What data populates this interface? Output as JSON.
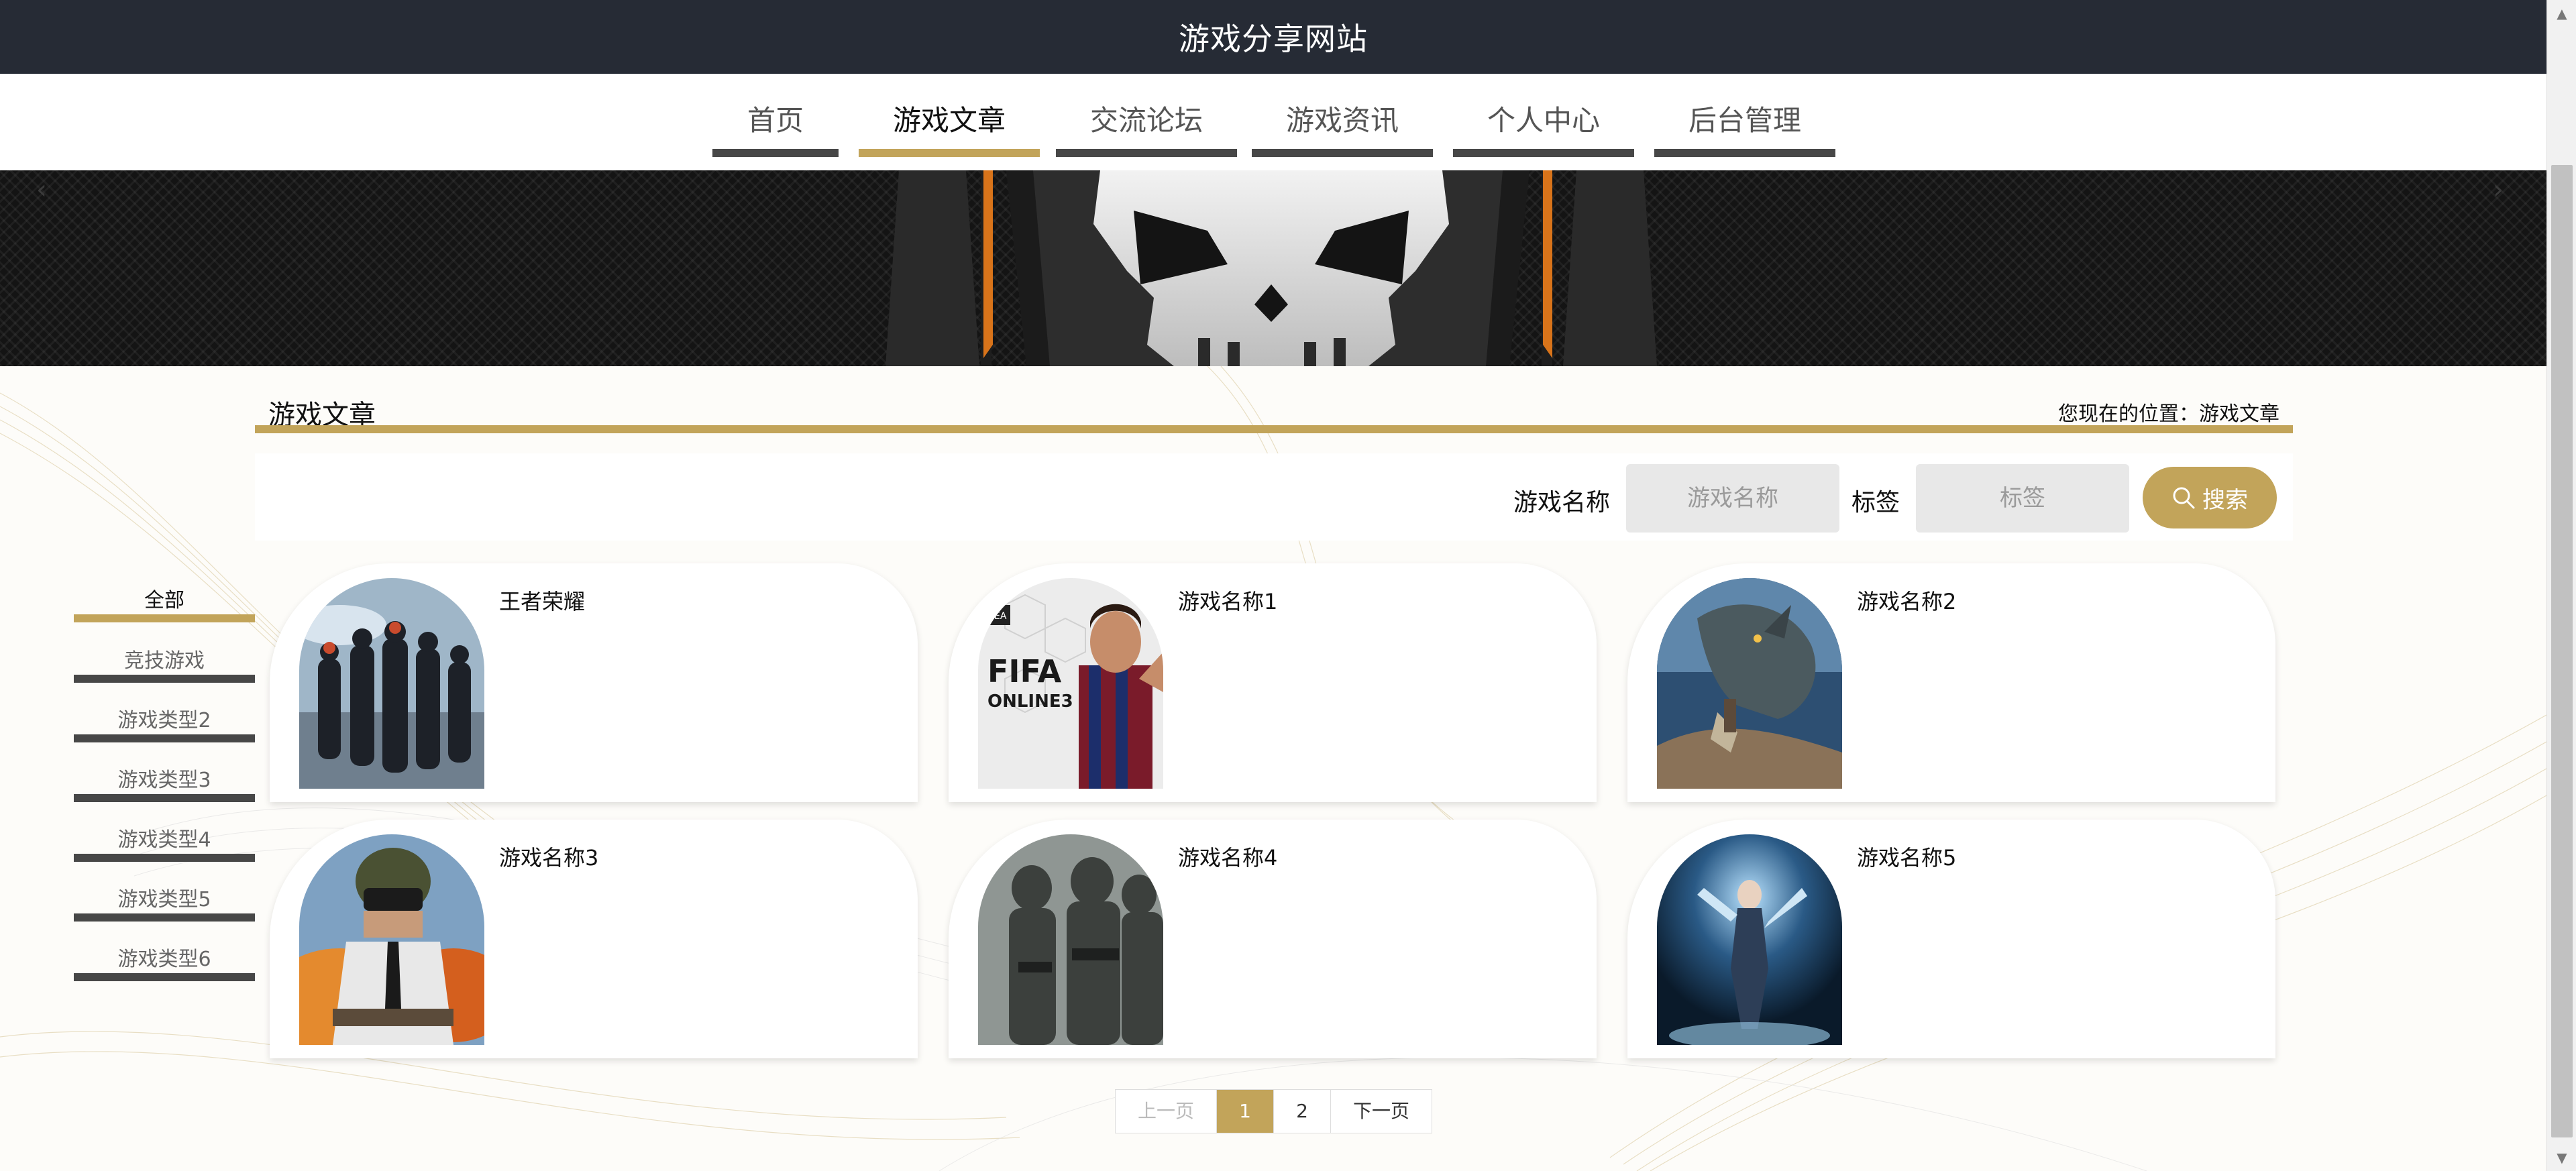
{
  "site": {
    "title": "游戏分享网站"
  },
  "nav": {
    "items": [
      {
        "label": "首页",
        "active": false
      },
      {
        "label": "游戏文章",
        "active": true
      },
      {
        "label": "交流论坛",
        "active": false
      },
      {
        "label": "游戏资讯",
        "active": false
      },
      {
        "label": "个人中心",
        "active": false
      },
      {
        "label": "后台管理",
        "active": false
      }
    ]
  },
  "banner": {
    "prev_icon": "chevron-left-icon",
    "next_icon": "chevron-right-icon"
  },
  "section": {
    "title": "游戏文章",
    "breadcrumb_prefix": "您现在的位置：",
    "breadcrumb_current": "游戏文章"
  },
  "search": {
    "name_label": "游戏名称",
    "name_placeholder": "游戏名称",
    "tag_label": "标签",
    "tag_placeholder": "标签",
    "button_label": "搜索",
    "button_icon": "search-icon"
  },
  "categories": [
    {
      "label": "全部",
      "active": true
    },
    {
      "label": "竞技游戏",
      "active": false
    },
    {
      "label": "游戏类型2",
      "active": false
    },
    {
      "label": "游戏类型3",
      "active": false
    },
    {
      "label": "游戏类型4",
      "active": false
    },
    {
      "label": "游戏类型5",
      "active": false
    },
    {
      "label": "游戏类型6",
      "active": false
    }
  ],
  "cards": [
    {
      "name": "王者荣耀",
      "image": "group-of-characters-image"
    },
    {
      "name": "游戏名称1",
      "image": "fifa-online3-image"
    },
    {
      "name": "游戏名称2",
      "image": "monster-hunter-image"
    },
    {
      "name": "游戏名称3",
      "image": "pubg-soldier-image"
    },
    {
      "name": "游戏名称4",
      "image": "soldiers-image"
    },
    {
      "name": "游戏名称5",
      "image": "fantasy-character-image"
    }
  ],
  "pagination": {
    "prev_label": "上一页",
    "pages": [
      "1",
      "2"
    ],
    "current": "1",
    "next_label": "下一页"
  },
  "colors": {
    "accent": "#c2a45a",
    "header": "#262b35",
    "bar_dark": "#474747"
  }
}
